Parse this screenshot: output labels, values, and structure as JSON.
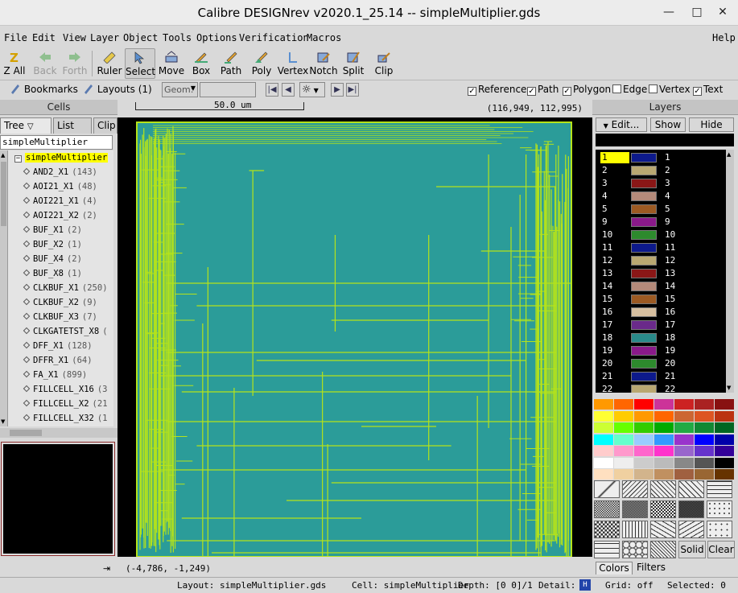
{
  "window": {
    "title": "Calibre DESIGNrev v2020.1_25.14  --  simpleMultiplier.gds",
    "minimize_glyph": "—",
    "maximize_glyph": "□",
    "close_glyph": "✕"
  },
  "menubar": {
    "items": [
      "File",
      "Edit",
      "View",
      "Layer",
      "Object",
      "Tools",
      "Options",
      "Verification",
      "Macros"
    ],
    "help": "Help"
  },
  "toolbar": {
    "buttons": [
      {
        "label": "Z All",
        "icon": "zoom-all-icon",
        "enabled": true
      },
      {
        "label": "Back",
        "icon": "back-arrow-icon",
        "enabled": false
      },
      {
        "label": "Forth",
        "icon": "forth-arrow-icon",
        "enabled": false
      },
      {
        "label": "Ruler",
        "icon": "ruler-icon",
        "enabled": true
      },
      {
        "label": "Select",
        "icon": "select-cursor-icon",
        "enabled": true,
        "active": true
      },
      {
        "label": "Move",
        "icon": "move-icon",
        "enabled": true
      },
      {
        "label": "Box",
        "icon": "box-pencil-icon",
        "enabled": true
      },
      {
        "label": "Path",
        "icon": "path-pencil-icon",
        "enabled": true
      },
      {
        "label": "Poly",
        "icon": "poly-pencil-icon",
        "enabled": true
      },
      {
        "label": "Vertex",
        "icon": "vertex-icon",
        "enabled": true
      },
      {
        "label": "Notch",
        "icon": "notch-icon",
        "enabled": true
      },
      {
        "label": "Split",
        "icon": "split-icon",
        "enabled": true
      },
      {
        "label": "Clip",
        "icon": "clip-icon",
        "enabled": true
      }
    ]
  },
  "toolbar2": {
    "bookmarks": "Bookmarks",
    "layouts": "Layouts (1)",
    "geom_label": "Geom:",
    "geom_value": "",
    "checks": [
      {
        "label": "Reference",
        "checked": true
      },
      {
        "label": "Path",
        "checked": true
      },
      {
        "label": "Polygon",
        "checked": true
      },
      {
        "label": "Edge",
        "checked": false
      },
      {
        "label": "Vertex",
        "checked": false
      },
      {
        "label": "Text",
        "checked": true
      }
    ]
  },
  "cells": {
    "header": "Cells",
    "tabs": [
      "Tree",
      "List",
      "Clip"
    ],
    "search_value": "simpleMultiplier",
    "root": "simpleMultiplier",
    "items": [
      {
        "name": "AND2_X1",
        "count": "(143)"
      },
      {
        "name": "AOI21_X1",
        "count": "(48)"
      },
      {
        "name": "AOI221_X1",
        "count": "(4)"
      },
      {
        "name": "AOI221_X2",
        "count": "(2)"
      },
      {
        "name": "BUF_X1",
        "count": "(2)"
      },
      {
        "name": "BUF_X2",
        "count": "(1)"
      },
      {
        "name": "BUF_X4",
        "count": "(2)"
      },
      {
        "name": "BUF_X8",
        "count": "(1)"
      },
      {
        "name": "CLKBUF_X1",
        "count": "(250)"
      },
      {
        "name": "CLKBUF_X2",
        "count": "(9)"
      },
      {
        "name": "CLKBUF_X3",
        "count": "(7)"
      },
      {
        "name": "CLKGATETST_X8",
        "count": "("
      },
      {
        "name": "DFF_X1",
        "count": "(128)"
      },
      {
        "name": "DFFR_X1",
        "count": "(64)"
      },
      {
        "name": "FA_X1",
        "count": "(899)"
      },
      {
        "name": "FILLCELL_X16",
        "count": "(3"
      },
      {
        "name": "FILLCELL_X2",
        "count": "(21"
      },
      {
        "name": "FILLCELL_X32",
        "count": "(1"
      }
    ]
  },
  "canvas": {
    "ruler_label": "50.0 um",
    "cursor_coords": "(116,949, 112,995)",
    "origin_coords": "(-4,786, -1,249)",
    "layout_bg": "#2b9c99",
    "route_color": "#b5e31a"
  },
  "layers": {
    "header": "Layers",
    "edit_button": "Edit...",
    "show_button": "Show",
    "hide_button": "Hide",
    "filter_value": "",
    "rows": [
      {
        "num": "1",
        "name": "1",
        "color": "#0d1a8c",
        "selected": true
      },
      {
        "num": "2",
        "name": "2",
        "color": "#b9a872"
      },
      {
        "num": "3",
        "name": "3",
        "color": "#8a1717"
      },
      {
        "num": "4",
        "name": "4",
        "color": "#b48a7a"
      },
      {
        "num": "5",
        "name": "5",
        "color": "#9c5a23"
      },
      {
        "num": "9",
        "name": "9",
        "color": "#8a1a8a"
      },
      {
        "num": "10",
        "name": "10",
        "color": "#2d8a2d"
      },
      {
        "num": "11",
        "name": "11",
        "color": "#0d1a8c"
      },
      {
        "num": "12",
        "name": "12",
        "color": "#b9a872"
      },
      {
        "num": "13",
        "name": "13",
        "color": "#8a1717"
      },
      {
        "num": "14",
        "name": "14",
        "color": "#b48a7a"
      },
      {
        "num": "15",
        "name": "15",
        "color": "#9c5a23"
      },
      {
        "num": "16",
        "name": "16",
        "color": "#d6bfa0"
      },
      {
        "num": "17",
        "name": "17",
        "color": "#6a2a8a"
      },
      {
        "num": "18",
        "name": "18",
        "color": "#2a8a8a"
      },
      {
        "num": "19",
        "name": "19",
        "color": "#8a1a8a"
      },
      {
        "num": "20",
        "name": "20",
        "color": "#2d8a2d"
      },
      {
        "num": "21",
        "name": "21",
        "color": "#0d1a8c"
      },
      {
        "num": "22",
        "name": "22",
        "color": "#b9a872"
      }
    ],
    "palette_rows": [
      [
        "#ff9900",
        "#ff6600",
        "#ff0000",
        "#cc3399",
        "#cc2222",
        "#aa2222",
        "#881111"
      ],
      [
        "#ffff33",
        "#ffcc00",
        "#ff9900",
        "#ff6600",
        "#cc6633",
        "#dd5522",
        "#bb3311"
      ],
      [
        "#ccff33",
        "#66ff00",
        "#33cc00",
        "#00aa00",
        "#22aa44",
        "#118833",
        "#006622"
      ],
      [
        "#00ffff",
        "#66ffcc",
        "#99ccff",
        "#3399ff",
        "#9933cc",
        "#0000ff",
        "#0000aa"
      ],
      [
        "#ffcccc",
        "#ff99cc",
        "#ff66cc",
        "#ff33cc",
        "#9966cc",
        "#6633cc",
        "#330099"
      ],
      [
        "#ffffff",
        "#eeeeee",
        "#cccccc",
        "#bbbbbb",
        "#888888",
        "#555555",
        "#000000"
      ],
      [
        "#ffe0c0",
        "#f0d0a0",
        "#d2b48c",
        "#c09060",
        "#a06040",
        "#996633",
        "#663300"
      ]
    ],
    "solid_button": "Solid",
    "clear_button": "Clear",
    "bottom_tabs": [
      "Colors",
      "Filters"
    ]
  },
  "statusbar": {
    "layout": "Layout: simpleMultiplier.gds",
    "cell": "Cell: simpleMultiplier",
    "depth": "Depth: [0 0]/1",
    "detail": "Detail:",
    "grid": "Grid: off",
    "selected": "Selected: 0"
  }
}
